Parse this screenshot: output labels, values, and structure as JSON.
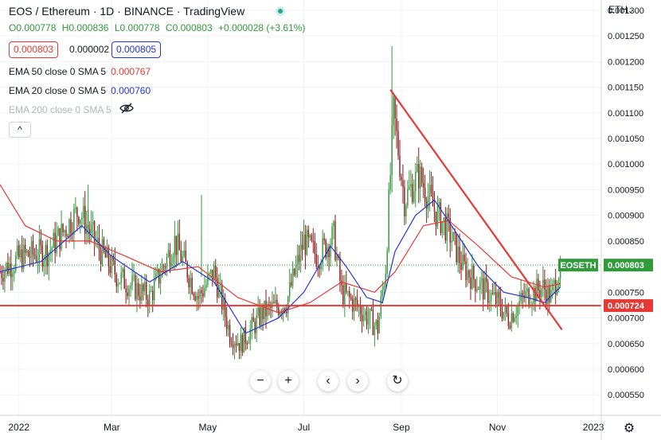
{
  "header": {
    "symbol": "EOS",
    "quote": "Ethereum",
    "interval": "1D",
    "exchange": "BINANCE",
    "brand": "TradingView",
    "title": "EOS / Ethereum · 1D · BINANCE · TradingView"
  },
  "ohlc": {
    "open_label": "O",
    "open": "0.000778",
    "high_label": "H",
    "high": "0.000836",
    "low_label": "L",
    "low": "0.000778",
    "close_label": "C",
    "close": "0.000803",
    "change": "+0.000028 (+3.61%)"
  },
  "bid_ask": {
    "bid": "0.000803",
    "spread": "0.000002",
    "ask": "0.000805"
  },
  "indicators": [
    {
      "label": "EMA 50 close 0 SMA 5",
      "value": "0.000767",
      "color": "#e53935"
    },
    {
      "label": "EMA 20 close 0 SMA 5",
      "value": "0.000760",
      "color": "#2434d6"
    },
    {
      "label": "EMA 200 close 0 SMA 5",
      "value": "",
      "color": "#b2b5be",
      "hidden": true
    }
  ],
  "controls": {
    "collapse": "^",
    "zoom_out": "−",
    "zoom_in": "+",
    "scroll_left": "‹",
    "scroll_right": "›",
    "reset": "↻",
    "currency": "ETH",
    "settings": "gear-icon"
  },
  "chart_data": {
    "type": "candlestick",
    "title": "EOS / Ethereum · 1D · BINANCE",
    "x_ticks": [
      "2022",
      "Mar",
      "May",
      "Jul",
      "Sep",
      "Nov",
      "2023"
    ],
    "y_ticks": [
      "0.001300",
      "0.001250",
      "0.001200",
      "0.001150",
      "0.001100",
      "0.001050",
      "0.001000",
      "0.000950",
      "0.000900",
      "0.000850",
      "0.000800",
      "0.000750",
      "0.000700",
      "0.000650",
      "0.000600",
      "0.000550"
    ],
    "ylim": [
      0.00051,
      0.00132
    ],
    "xlim": [
      "2021-12-20",
      "2023-01-06"
    ],
    "up_color": "#2f9b3a",
    "down_color": "#8b1a1a",
    "last_price_label": "EOSETH",
    "last_price": "0.000803",
    "support_price_label": "0.000724",
    "support_level": 0.000724,
    "trendline": {
      "start": [
        "2022-08-25",
        0.001145
      ],
      "end": [
        "2022-12-12",
        0.000677
      ],
      "color": "#e53935"
    },
    "support_color": "#e53935",
    "series_anchors": {
      "close": [
        [
          "2021-12-20",
          0.00079
        ],
        [
          "2022-01-03",
          0.00082
        ],
        [
          "2022-01-20",
          0.00083
        ],
        [
          "2022-02-01",
          0.00088
        ],
        [
          "2022-02-08",
          0.00091
        ],
        [
          "2022-02-22",
          0.00083
        ],
        [
          "2022-03-05",
          0.00078
        ],
        [
          "2022-03-15",
          0.00076
        ],
        [
          "2022-03-25",
          0.00074
        ],
        [
          "2022-04-10",
          0.00085
        ],
        [
          "2022-04-25",
          0.00074
        ],
        [
          "2022-05-05",
          0.00079
        ],
        [
          "2022-05-15",
          0.00067
        ],
        [
          "2022-05-22",
          0.00065
        ],
        [
          "2022-06-05",
          0.00071
        ],
        [
          "2022-06-20",
          0.00073
        ],
        [
          "2022-07-01",
          0.00085
        ],
        [
          "2022-07-10",
          0.00082
        ],
        [
          "2022-07-20",
          0.00086
        ],
        [
          "2022-07-25",
          0.00075
        ],
        [
          "2022-08-05",
          0.00072
        ],
        [
          "2022-08-17",
          0.00068
        ],
        [
          "2022-08-22",
          0.0008
        ],
        [
          "2022-08-27",
          0.0011
        ],
        [
          "2022-09-03",
          0.00093
        ],
        [
          "2022-09-12",
          0.00098
        ],
        [
          "2022-09-22",
          0.00091
        ],
        [
          "2022-10-01",
          0.00087
        ],
        [
          "2022-10-10",
          0.0008
        ],
        [
          "2022-10-22",
          0.00076
        ],
        [
          "2022-11-01",
          0.00073
        ],
        [
          "2022-11-08",
          0.0007
        ],
        [
          "2022-11-18",
          0.00074
        ],
        [
          "2022-11-30",
          0.00076
        ],
        [
          "2022-12-05",
          0.00074
        ],
        [
          "2022-12-11",
          0.000803
        ]
      ],
      "ema20": [
        [
          "2021-12-20",
          0.00079
        ],
        [
          "2022-01-15",
          0.00081
        ],
        [
          "2022-02-10",
          0.00088
        ],
        [
          "2022-03-01",
          0.00082
        ],
        [
          "2022-03-25",
          0.00077
        ],
        [
          "2022-04-15",
          0.00081
        ],
        [
          "2022-05-05",
          0.00077
        ],
        [
          "2022-05-25",
          0.00067
        ],
        [
          "2022-06-15",
          0.0007
        ],
        [
          "2022-07-01",
          0.00075
        ],
        [
          "2022-07-18",
          0.00084
        ],
        [
          "2022-07-28",
          0.0008
        ],
        [
          "2022-08-10",
          0.00074
        ],
        [
          "2022-08-20",
          0.00073
        ],
        [
          "2022-08-28",
          0.00083
        ],
        [
          "2022-09-10",
          0.0009
        ],
        [
          "2022-09-22",
          0.00093
        ],
        [
          "2022-10-05",
          0.00087
        ],
        [
          "2022-10-20",
          0.0008
        ],
        [
          "2022-11-05",
          0.00075
        ],
        [
          "2022-11-20",
          0.00074
        ],
        [
          "2022-12-01",
          0.00073
        ],
        [
          "2022-12-11",
          0.00076
        ]
      ],
      "ema50": [
        [
          "2021-12-20",
          0.00096
        ],
        [
          "2022-01-05",
          0.00088
        ],
        [
          "2022-01-25",
          0.00085
        ],
        [
          "2022-02-15",
          0.00085
        ],
        [
          "2022-03-10",
          0.00082
        ],
        [
          "2022-04-01",
          0.00079
        ],
        [
          "2022-04-25",
          0.0008
        ],
        [
          "2022-05-20",
          0.00074
        ],
        [
          "2022-06-15",
          0.00071
        ],
        [
          "2022-07-05",
          0.00073
        ],
        [
          "2022-07-25",
          0.00077
        ],
        [
          "2022-08-15",
          0.00075
        ],
        [
          "2022-08-28",
          0.00079
        ],
        [
          "2022-09-15",
          0.00088
        ],
        [
          "2022-10-01",
          0.00089
        ],
        [
          "2022-10-20",
          0.00084
        ],
        [
          "2022-11-10",
          0.00078
        ],
        [
          "2022-12-01",
          0.00076
        ],
        [
          "2022-12-11",
          0.000767
        ]
      ]
    }
  }
}
